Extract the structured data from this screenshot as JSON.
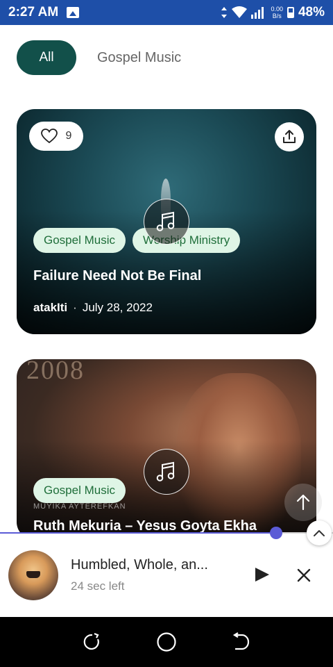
{
  "status_bar": {
    "time": "2:27 AM",
    "net_speed_value": "0.00",
    "net_speed_unit": "B/s",
    "battery": "48%"
  },
  "filters": {
    "all_label": "All",
    "gospel_label": "Gospel Music"
  },
  "cards": [
    {
      "likes": "9",
      "tags": [
        "Gospel Music",
        "Worship Ministry"
      ],
      "title": "Failure Need Not Be Final",
      "author": "atakIti",
      "separator": "·",
      "date": "July 28, 2022"
    },
    {
      "overlay_year": "2008",
      "overlay_sub": "MUYIKA AYTEREFKAN",
      "tags": [
        "Gospel Music"
      ],
      "title": "Ruth Mekuria – Yesus Goyta Ekha"
    }
  ],
  "player": {
    "title": "Humbled, Whole, an...",
    "time_left": "24 sec left",
    "progress": 0.83
  },
  "colors": {
    "status_bar": "#1e4fa8",
    "chip_active": "#12504a",
    "tag_bg": "#dff5e6",
    "tag_text": "#1f6e3a",
    "progress": "#5b5bd6"
  },
  "icons": {
    "like": "heart-icon",
    "share": "share-icon",
    "music": "music-note-icon",
    "scroll_top": "arrow-up-icon",
    "expand": "chevron-up-icon",
    "play": "play-icon",
    "close": "close-icon"
  }
}
